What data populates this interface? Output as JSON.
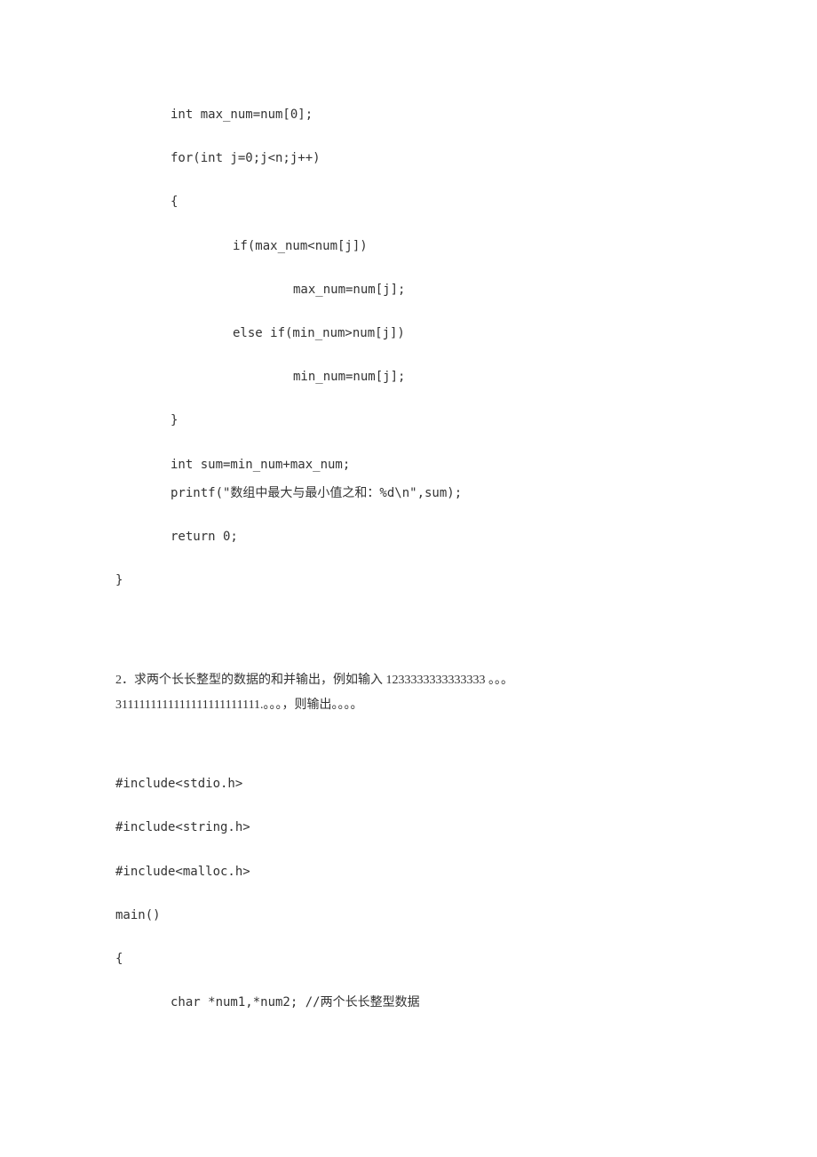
{
  "code_block_1": {
    "l1": "int max_num=num[0];",
    "l2": "for(int j=0;j<n;j++)",
    "l3": "{",
    "l4": "if(max_num<num[j])",
    "l5": "max_num=num[j];",
    "l6": "else if(min_num>num[j])",
    "l7": "min_num=num[j];",
    "l8": "}",
    "l9": "int sum=min_num+max_num;",
    "l10": "printf(\"数组中最大与最小值之和：%d\\n\",sum);",
    "l11": "return 0;",
    "l12": "}"
  },
  "problem2": {
    "line1": "2．求两个长长整型的数据的和并输出，例如输入 1233333333333333 。。。",
    "line2": "3111111111111111111111111.。。。，则输出。。。。"
  },
  "code_block_2": {
    "l1": "#include<stdio.h>",
    "l2": "#include<string.h>",
    "l3": "#include<malloc.h>",
    "l4": "main()",
    "l5": "{",
    "l6": "char *num1,*num2; //两个长长整型数据"
  }
}
